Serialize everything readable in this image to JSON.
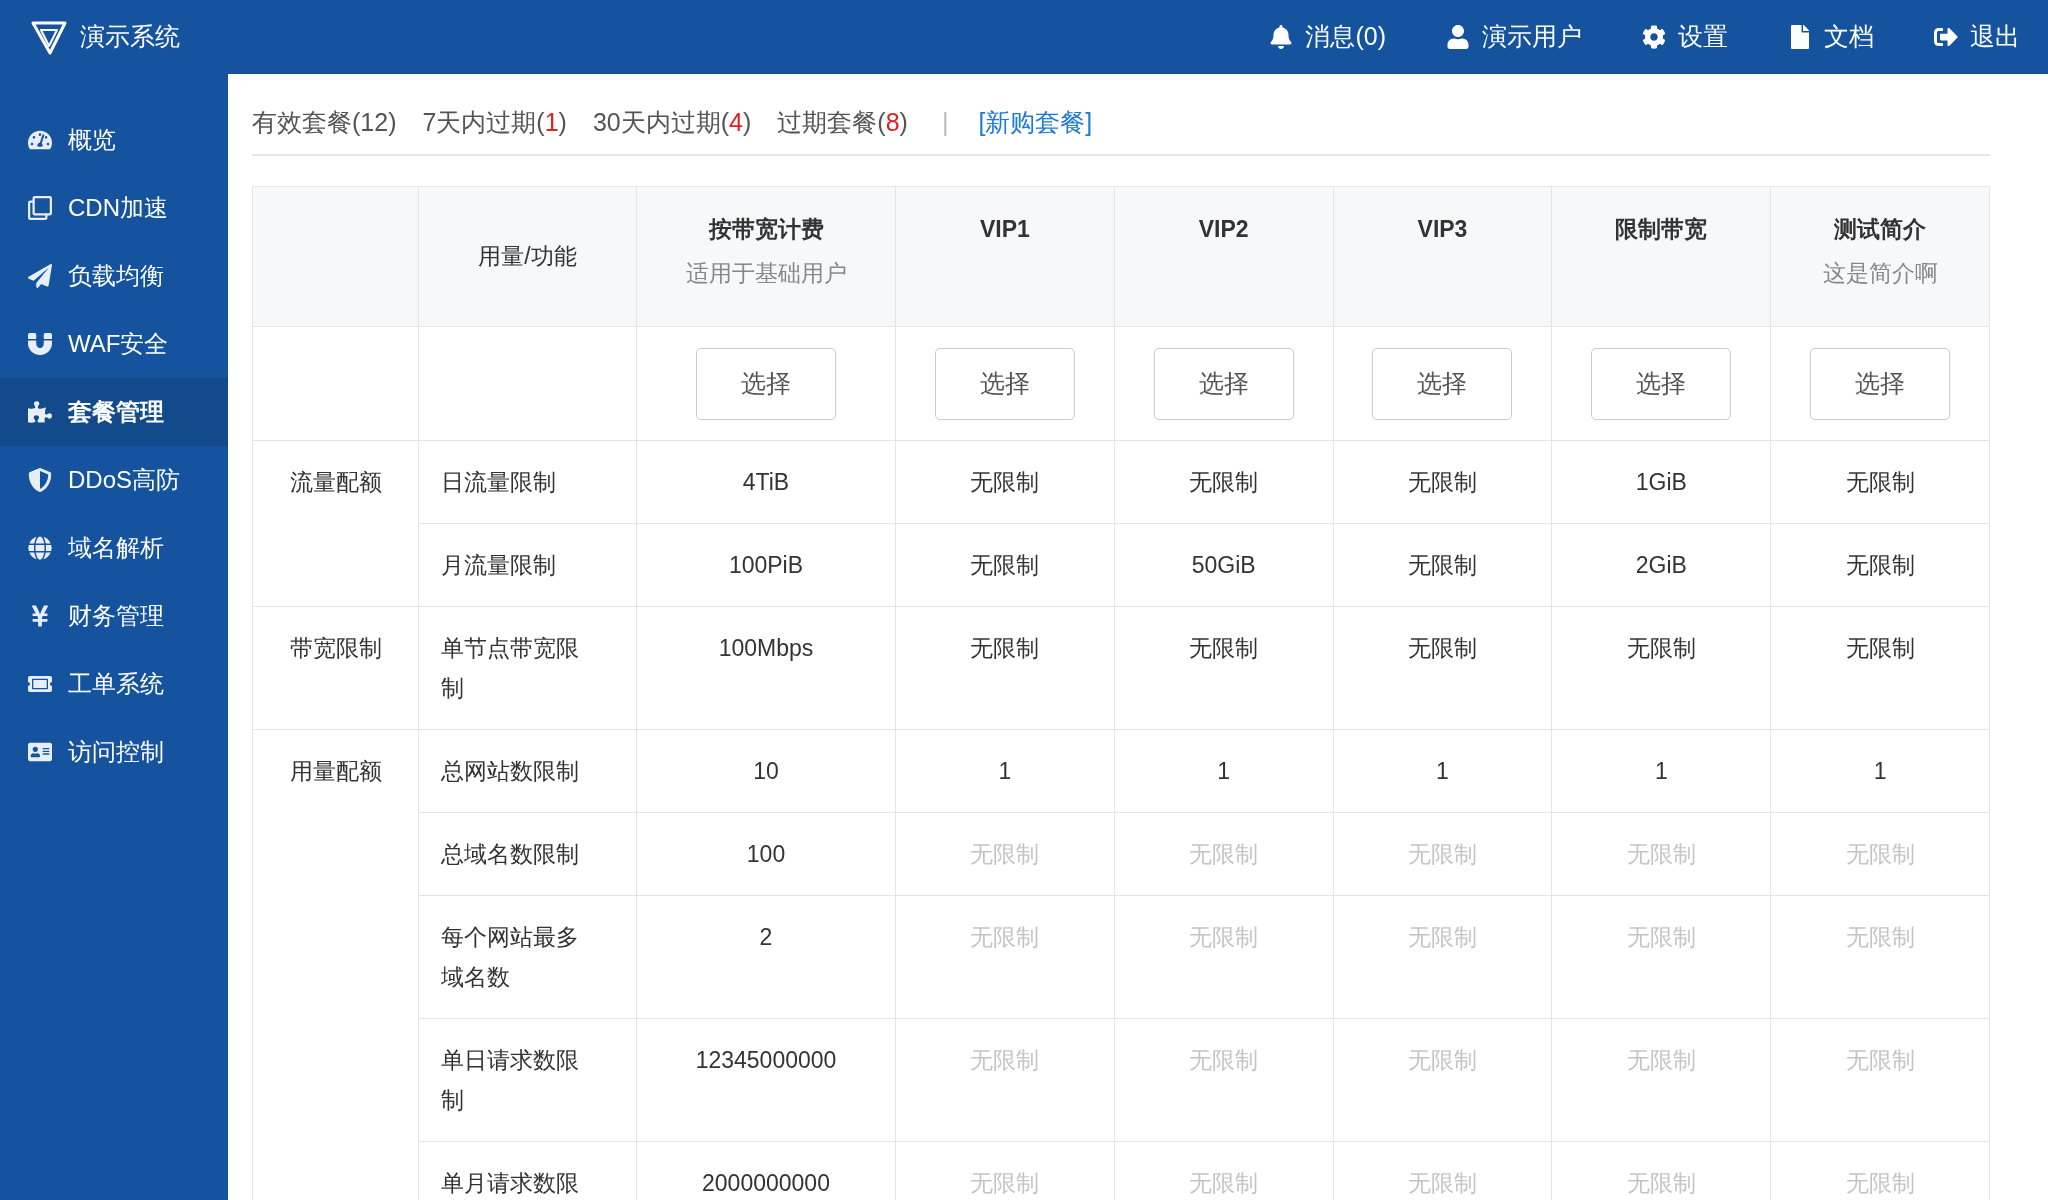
{
  "app": {
    "title": "演示系统"
  },
  "top_nav": [
    {
      "label": "消息(0)"
    },
    {
      "label": "演示用户"
    },
    {
      "label": "设置"
    },
    {
      "label": "文档"
    },
    {
      "label": "退出"
    }
  ],
  "sidebar": {
    "items": [
      {
        "label": "概览",
        "selected": false
      },
      {
        "label": "CDN加速",
        "selected": false
      },
      {
        "label": "负载均衡",
        "selected": false
      },
      {
        "label": "WAF安全",
        "selected": false
      },
      {
        "label": "套餐管理",
        "selected": true
      },
      {
        "label": "DDoS高防",
        "selected": false
      },
      {
        "label": "域名解析",
        "selected": false
      },
      {
        "label": "财务管理",
        "selected": false
      },
      {
        "label": "工单系统",
        "selected": false
      },
      {
        "label": "访问控制",
        "selected": false
      }
    ]
  },
  "filter_tabs": [
    {
      "prefix": "有效套餐(",
      "count": "12",
      "suffix": ")",
      "alert": false
    },
    {
      "prefix": "7天内过期(",
      "count": "1",
      "suffix": ")",
      "alert": true
    },
    {
      "prefix": "30天内过期(",
      "count": "4",
      "suffix": ")",
      "alert": true
    },
    {
      "prefix": "过期套餐(",
      "count": "8",
      "suffix": ")",
      "alert": true
    }
  ],
  "separator": "|",
  "new_link": "[新购套餐]",
  "table": {
    "feature_heading": "用量/功能",
    "plans": [
      {
        "name": "按带宽计费",
        "subtitle": "适用于基础用户",
        "button": "选择"
      },
      {
        "name": "VIP1",
        "button": "选择"
      },
      {
        "name": "VIP2",
        "button": "选择"
      },
      {
        "name": "VIP3",
        "button": "选择"
      },
      {
        "name": "限制带宽",
        "button": "选择"
      },
      {
        "name": "测试简介",
        "subtitle": "这是简介啊",
        "button": "选择"
      }
    ],
    "groups": [
      {
        "label": "流量配额",
        "rows": [
          {
            "feature": "日流量限制",
            "values": [
              {
                "text": "4TiB",
                "dimmed": false
              },
              {
                "text": "无限制",
                "dimmed": false
              },
              {
                "text": "无限制",
                "dimmed": false
              },
              {
                "text": "无限制",
                "dimmed": false
              },
              {
                "text": "1GiB",
                "dimmed": false
              },
              {
                "text": "无限制",
                "dimmed": false
              }
            ]
          },
          {
            "feature": "月流量限制",
            "values": [
              {
                "text": "100PiB",
                "dimmed": false
              },
              {
                "text": "无限制",
                "dimmed": false
              },
              {
                "text": "50GiB",
                "dimmed": false
              },
              {
                "text": "无限制",
                "dimmed": false
              },
              {
                "text": "2GiB",
                "dimmed": false
              },
              {
                "text": "无限制",
                "dimmed": false
              }
            ]
          }
        ]
      },
      {
        "label": "带宽限制",
        "rows": [
          {
            "feature": "单节点带宽限制",
            "values": [
              {
                "text": "100Mbps",
                "dimmed": false
              },
              {
                "text": "无限制",
                "dimmed": false
              },
              {
                "text": "无限制",
                "dimmed": false
              },
              {
                "text": "无限制",
                "dimmed": false
              },
              {
                "text": "无限制",
                "dimmed": false
              },
              {
                "text": "无限制",
                "dimmed": false
              }
            ]
          }
        ]
      },
      {
        "label": "用量配额",
        "rows": [
          {
            "feature": "总网站数限制",
            "values": [
              {
                "text": "10",
                "dimmed": false
              },
              {
                "text": "1",
                "dimmed": false
              },
              {
                "text": "1",
                "dimmed": false
              },
              {
                "text": "1",
                "dimmed": false
              },
              {
                "text": "1",
                "dimmed": false
              },
              {
                "text": "1",
                "dimmed": false
              }
            ]
          },
          {
            "feature": "总域名数限制",
            "values": [
              {
                "text": "100",
                "dimmed": false
              },
              {
                "text": "无限制",
                "dimmed": true
              },
              {
                "text": "无限制",
                "dimmed": true
              },
              {
                "text": "无限制",
                "dimmed": true
              },
              {
                "text": "无限制",
                "dimmed": true
              },
              {
                "text": "无限制",
                "dimmed": true
              }
            ]
          },
          {
            "feature": "每个网站最多域名数",
            "values": [
              {
                "text": "2",
                "dimmed": false
              },
              {
                "text": "无限制",
                "dimmed": true
              },
              {
                "text": "无限制",
                "dimmed": true
              },
              {
                "text": "无限制",
                "dimmed": true
              },
              {
                "text": "无限制",
                "dimmed": true
              },
              {
                "text": "无限制",
                "dimmed": true
              }
            ]
          },
          {
            "feature": "单日请求数限制",
            "values": [
              {
                "text": "12345000000",
                "dimmed": false
              },
              {
                "text": "无限制",
                "dimmed": true
              },
              {
                "text": "无限制",
                "dimmed": true
              },
              {
                "text": "无限制",
                "dimmed": true
              },
              {
                "text": "无限制",
                "dimmed": true
              },
              {
                "text": "无限制",
                "dimmed": true
              }
            ]
          },
          {
            "feature": "单月请求数限",
            "values": [
              {
                "text": "2000000000",
                "dimmed": false
              },
              {
                "text": "无限制",
                "dimmed": true
              },
              {
                "text": "无限制",
                "dimmed": true
              },
              {
                "text": "无限制",
                "dimmed": true
              },
              {
                "text": "无限制",
                "dimmed": true
              },
              {
                "text": "无限制",
                "dimmed": true
              }
            ]
          }
        ]
      }
    ]
  }
}
